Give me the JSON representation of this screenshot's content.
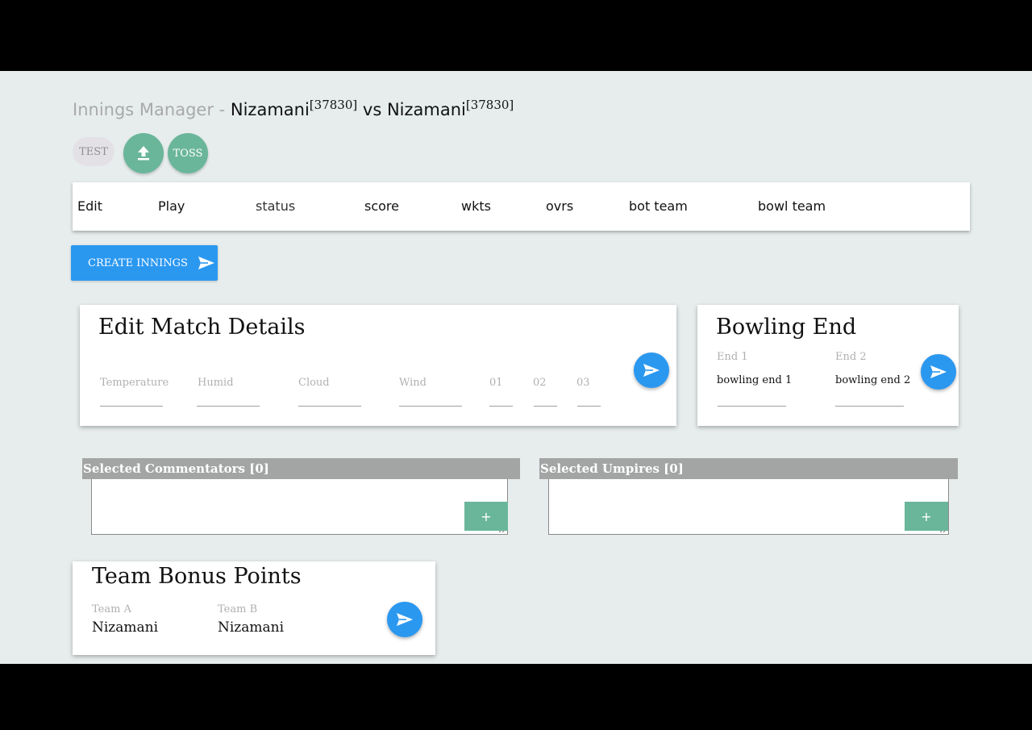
{
  "header": {
    "prefix": "Innings Manager - ",
    "team1": "Nizamani",
    "team1_id": "[37830]",
    "vs": " vs ",
    "team2": "Nizamani",
    "team2_id": "[37830]"
  },
  "chips": {
    "test_label": "TEST",
    "upload_icon": "upload-icon",
    "toss_label": "TOSS"
  },
  "table": {
    "columns": [
      "Edit",
      "Play",
      "status",
      "score",
      "wkts",
      "ovrs",
      "bot team",
      "bowl team"
    ]
  },
  "create_innings": {
    "label": "CREATE INNINGS",
    "icon": "send-icon"
  },
  "match_details": {
    "title": "Edit Match Details",
    "fields": [
      "Temperature",
      "Humid",
      "Cloud",
      "Wind",
      "01",
      "02",
      "03"
    ]
  },
  "bowling_end": {
    "title": "Bowling End",
    "end1_label": "End 1",
    "end1_value": "bowling end 1",
    "end2_label": "End 2",
    "end2_value": "bowling end 2"
  },
  "commentators": {
    "header": "Selected Commentators [0]",
    "add_label": "+"
  },
  "umpires": {
    "header": "Selected Umpires [0]",
    "add_label": "+"
  },
  "bonus_points": {
    "title": "Team Bonus Points",
    "team_a_label": "Team A",
    "team_a_value": "Nizamani",
    "team_b_label": "Team B",
    "team_b_value": "Nizamani"
  },
  "colors": {
    "background": "#e7eded",
    "accent_blue": "#2b98f0",
    "accent_green": "#6ab69b",
    "panel_header_grey": "#a3a5a4"
  }
}
